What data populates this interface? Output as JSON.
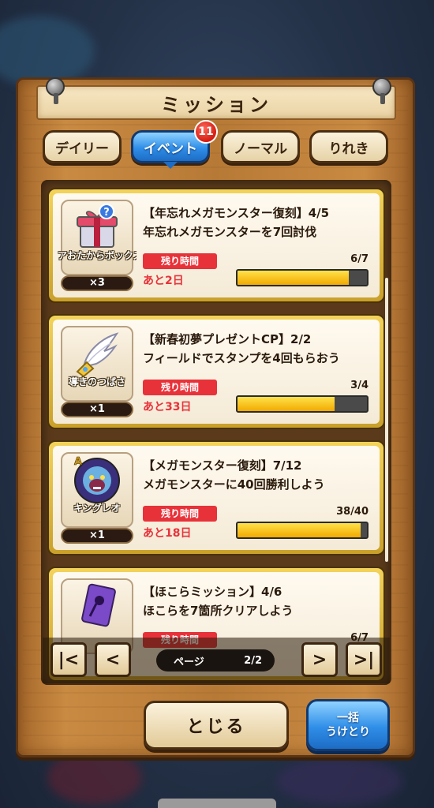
{
  "title": "ミッション",
  "tabs": [
    {
      "label": "デイリー",
      "active": false
    },
    {
      "label": "イベント",
      "active": true,
      "badge": "11"
    },
    {
      "label": "ノーマル",
      "active": false
    },
    {
      "label": "りれき",
      "active": false
    }
  ],
  "missions": [
    {
      "title": "【年忘れメガモンスター復刻】4/5",
      "description": "年忘れメガモンスターを7回討伐",
      "time_label": "残り時間",
      "time_value": "あと2日",
      "progress_text": "6/7",
      "progress_fraction": 0.857,
      "reward_name": "アおたからボックス",
      "reward_count": "×3",
      "reward_icon": "gift-box-icon"
    },
    {
      "title": "【新春初夢プレゼントCP】2/2",
      "description": "フィールドでスタンプを4回もらおう",
      "time_label": "残り時間",
      "time_value": "あと33日",
      "progress_text": "3/4",
      "progress_fraction": 0.75,
      "reward_name": "導きのつばさ",
      "reward_count": "×1",
      "reward_icon": "wing-icon"
    },
    {
      "title": "【メガモンスター復刻】7/12",
      "description": "メガモンスターに40回勝利しよう",
      "time_label": "残り時間",
      "time_value": "あと18日",
      "progress_text": "38/40",
      "progress_fraction": 0.95,
      "reward_name": "キングレオ",
      "reward_count": "×1",
      "reward_icon": "monster-icon",
      "reward_rank": "A"
    },
    {
      "title": "【ほこらミッション】4/6",
      "description": "ほこらを7箇所クリアしよう",
      "time_label": "残り時間",
      "time_value": "",
      "progress_text": "6/7",
      "progress_fraction": 0.857,
      "reward_name": "",
      "reward_count": "",
      "reward_icon": "purple-card-icon"
    }
  ],
  "pager": {
    "label": "ページ",
    "value": "2/2",
    "first_icon": "first-page-icon",
    "prev_icon": "prev-page-icon",
    "next_icon": "next-page-icon",
    "last_icon": "last-page-icon"
  },
  "buttons": {
    "close_label": "とじる",
    "claim_line1": "一括",
    "claim_line2": "うけとり"
  },
  "colors": {
    "accent_blue": "#2f8ee8",
    "wood": "#c98a42",
    "time_red": "#e8323a",
    "progress_yellow": "#ffcc00"
  }
}
